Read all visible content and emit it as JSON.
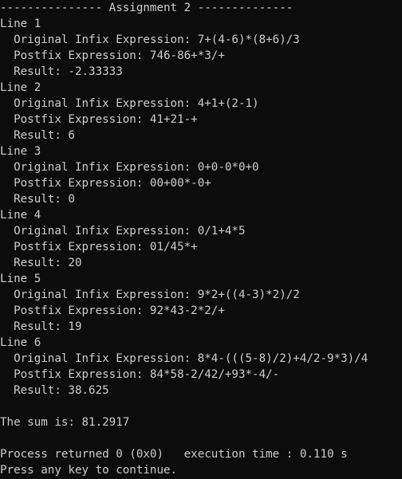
{
  "header": "--------------- Assignment 2 --------------",
  "entries": [
    {
      "label": "Line 1",
      "infix": "  Original Infix Expression: 7+(4-6)*(8+6)/3",
      "postfix": "  Postfix Expression: 746-86+*3/+",
      "result": "  Result: -2.33333"
    },
    {
      "label": "Line 2",
      "infix": "  Original Infix Expression: 4+1+(2-1)",
      "postfix": "  Postfix Expression: 41+21-+",
      "result": "  Result: 6"
    },
    {
      "label": "Line 3",
      "infix": "  Original Infix Expression: 0+0-0*0+0",
      "postfix": "  Postfix Expression: 00+00*-0+",
      "result": "  Result: 0"
    },
    {
      "label": "Line 4",
      "infix": "  Original Infix Expression: 0/1+4*5",
      "postfix": "  Postfix Expression: 01/45*+",
      "result": "  Result: 20"
    },
    {
      "label": "Line 5",
      "infix": "  Original Infix Expression: 9*2+((4-3)*2)/2",
      "postfix": "  Postfix Expression: 92*43-2*2/+",
      "result": "  Result: 19"
    },
    {
      "label": "Line 6",
      "infix": "  Original Infix Expression: 8*4-(((5-8)/2)+4/2-9*3)/4",
      "postfix": "  Postfix Expression: 84*58-2/42/+93*-4/-",
      "result": "  Result: 38.625"
    }
  ],
  "sum": "The sum is: 81.2917",
  "process": "Process returned 0 (0x0)   execution time : 0.110 s",
  "prompt": "Press any key to continue."
}
